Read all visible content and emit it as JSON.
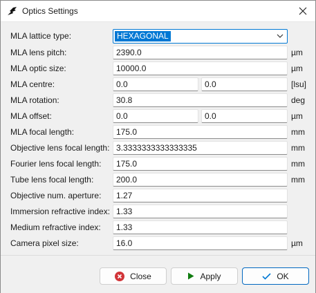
{
  "window": {
    "title": "Optics Settings"
  },
  "form": {
    "lattice_type": {
      "label": "MLA lattice type:",
      "value": "HEXAGONAL"
    },
    "lens_pitch": {
      "label": "MLA lens pitch:",
      "value": "2390.0",
      "unit": "µm"
    },
    "optic_size": {
      "label": "MLA optic size:",
      "value": "10000.0",
      "unit": "µm"
    },
    "centre": {
      "label": "MLA centre:",
      "value_x": "0.0",
      "value_y": "0.0",
      "unit": "[lsu]"
    },
    "rotation": {
      "label": "MLA rotation:",
      "value": "30.8",
      "unit": "deg"
    },
    "offset": {
      "label": "MLA offset:",
      "value_x": "0.0",
      "value_y": "0.0",
      "unit": "µm"
    },
    "focal_length": {
      "label": "MLA focal length:",
      "value": "175.0",
      "unit": "mm"
    },
    "objective_focal": {
      "label": "Objective lens focal length:",
      "value": "3.3333333333333335",
      "unit": "mm"
    },
    "fourier_focal": {
      "label": "Fourier lens focal length:",
      "value": "175.0",
      "unit": "mm"
    },
    "tube_focal": {
      "label": "Tube lens focal length:",
      "value": "200.0",
      "unit": "mm"
    },
    "num_aperture": {
      "label": "Objective num. aperture:",
      "value": "1.27"
    },
    "immersion_index": {
      "label": "Immersion refractive index:",
      "value": "1.33"
    },
    "medium_index": {
      "label": "Medium refractive index:",
      "value": "1.33"
    },
    "pixel_size": {
      "label": "Camera pixel size:",
      "value": "16.0",
      "unit": "µm"
    }
  },
  "buttons": {
    "close": "Close",
    "apply": "Apply",
    "ok": "OK"
  },
  "colors": {
    "accent": "#0078d4",
    "close_icon": "#d13438",
    "apply_icon": "#107c10",
    "ok_icon": "#0078d4"
  }
}
